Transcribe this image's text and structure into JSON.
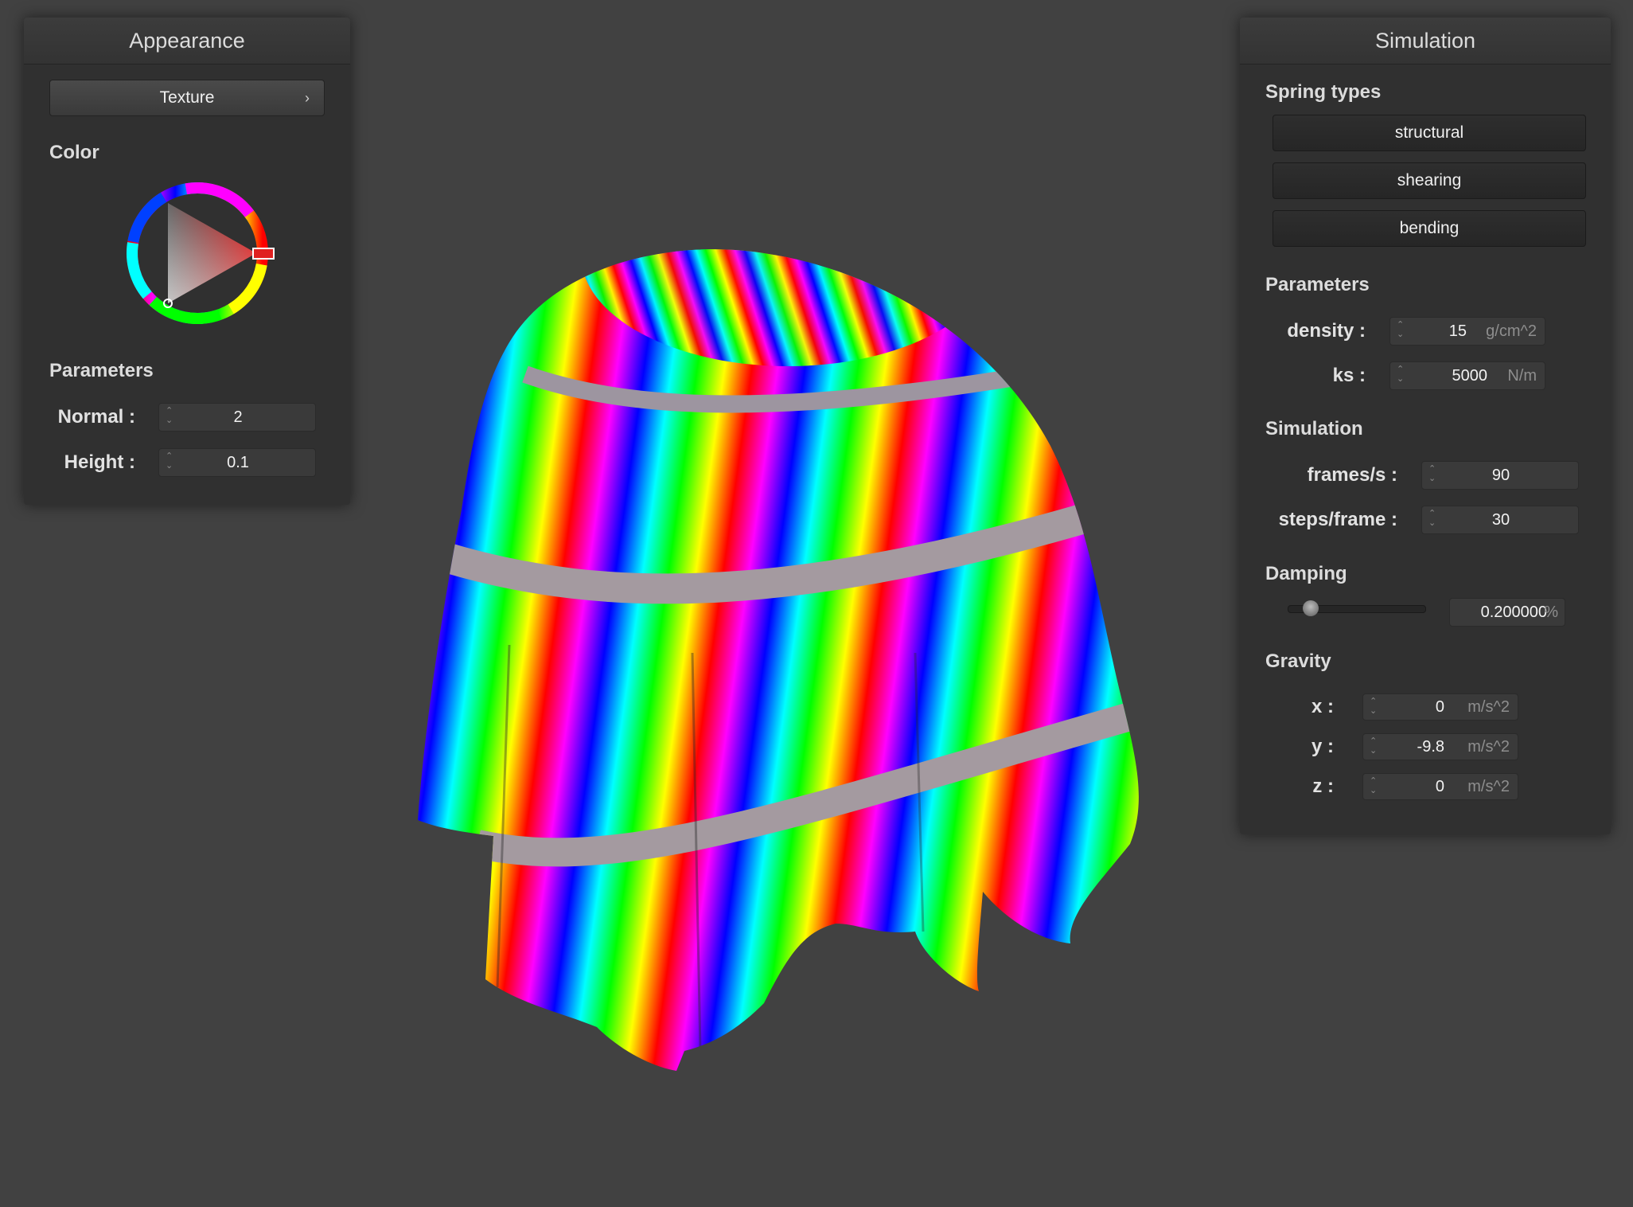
{
  "appearance": {
    "title": "Appearance",
    "texture_button": "Texture",
    "color_label": "Color",
    "selected_color": "#e02020",
    "parameters_label": "Parameters",
    "fields": [
      {
        "label": "Normal :",
        "value": "2"
      },
      {
        "label": "Height :",
        "value": "0.1"
      }
    ]
  },
  "simulation": {
    "title": "Simulation",
    "spring_types_label": "Spring types",
    "spring_buttons": [
      "structural",
      "shearing",
      "bending"
    ],
    "parameters_label": "Parameters",
    "parameters": [
      {
        "label": "density :",
        "value": "15",
        "unit": "g/cm^2"
      },
      {
        "label": "ks :",
        "value": "5000",
        "unit": "N/m"
      }
    ],
    "simulation_label": "Simulation",
    "simulation_fields": [
      {
        "label": "frames/s :",
        "value": "90"
      },
      {
        "label": "steps/frame :",
        "value": "30"
      }
    ],
    "damping_label": "Damping",
    "damping_value": "0.200000",
    "damping_unit": "%",
    "damping_slider_fraction": 0.12,
    "gravity_label": "Gravity",
    "gravity": [
      {
        "label": "x :",
        "value": "0",
        "unit": "m/s^2"
      },
      {
        "label": "y :",
        "value": "-9.8",
        "unit": "m/s^2"
      },
      {
        "label": "z :",
        "value": "0",
        "unit": "m/s^2"
      }
    ]
  }
}
